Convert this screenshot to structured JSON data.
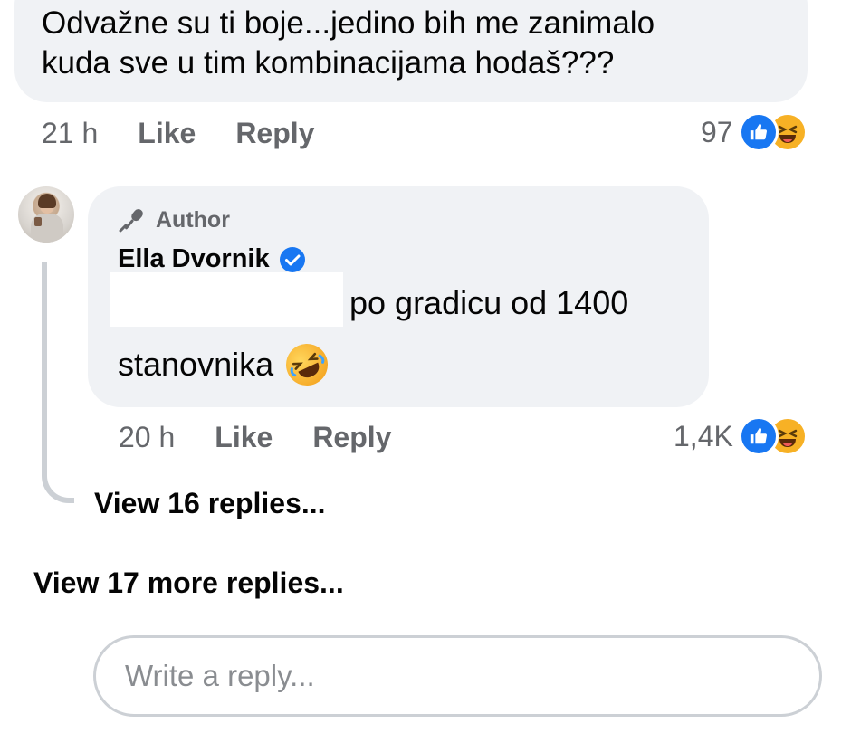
{
  "top_comment": {
    "text": "Odvažne su ti boje...jedino bih me zanimalo\nkuda sve u tim kombinacijama hodaš???",
    "time": "21 h",
    "like_label": "Like",
    "reply_label": "Reply",
    "reaction_count": "97"
  },
  "reply": {
    "badge": "Author",
    "author_name": "Ella Dvornik",
    "text_line1": "po gradicu od 1400",
    "text_line2": "stanovnika",
    "time": "20 h",
    "like_label": "Like",
    "reply_label": "Reply",
    "reaction_count": "1,4K"
  },
  "links": {
    "view_replies": "View 16 replies...",
    "view_more_replies": "View 17 more replies..."
  },
  "composer": {
    "placeholder": "Write a reply..."
  },
  "colors": {
    "bubble_bg": "#f0f2f5",
    "meta_text": "#65676b",
    "like_blue": "#1877f2",
    "haha_yellow": "#f7b125"
  },
  "icons": [
    "like-reaction-icon",
    "haha-reaction-icon",
    "microphone-icon",
    "verified-badge-icon",
    "rofl-emoji"
  ]
}
